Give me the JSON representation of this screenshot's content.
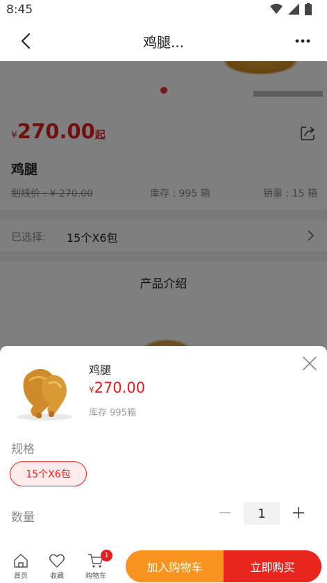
{
  "status_bar": {
    "time": "8:45",
    "icons": [
      "wifi-icon",
      "signal-icon",
      "battery-icon"
    ]
  },
  "nav": {
    "title": "鸡腿...",
    "back_icon": "chevron-left-icon",
    "more_icon": "more-dots-icon"
  },
  "product": {
    "currency": "¥",
    "price": "270.00",
    "price_suffix": "起",
    "name": "鸡腿",
    "original_price": "划线价 : ¥ 270.00",
    "stock": "库存 : 995 箱",
    "sales": "销量 : 15 箱"
  },
  "selection": {
    "label": "已选择:",
    "value": "15个X6包"
  },
  "intro": {
    "title": "产品介绍"
  },
  "sheet": {
    "name": "鸡腿",
    "currency": "¥",
    "price": "270.00",
    "stock": "库存 995箱",
    "spec_label": "规格",
    "spec_option": "15个X6包",
    "qty_label": "数量",
    "qty_value": "1"
  },
  "bottom_bar": {
    "home_label": "首页",
    "fav_label": "收藏",
    "cart_label": "购物车",
    "cart_badge": "1",
    "add_to_cart": "加入购物车",
    "buy_now": "立即购买"
  },
  "colors": {
    "accent_red": "#e02020",
    "cart_orange": "#f7931e",
    "buy_red": "#e8261e"
  }
}
